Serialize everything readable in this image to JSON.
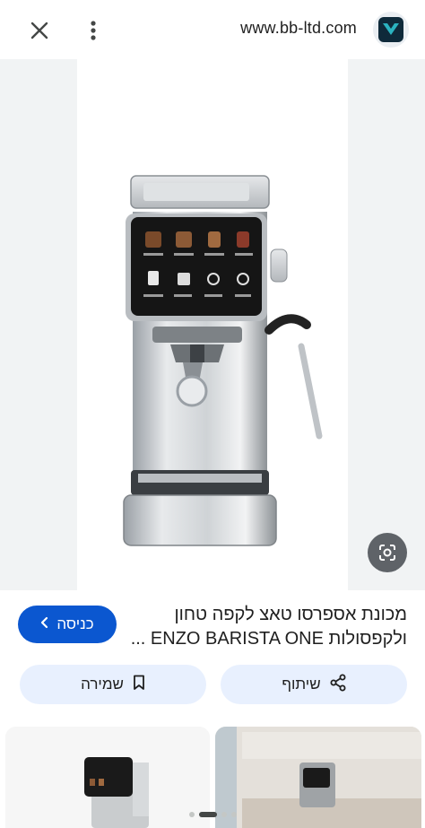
{
  "topbar": {
    "domain": "www.bb-ltd.com",
    "close_icon": "close-icon",
    "more_icon": "more-vert-icon",
    "logo_icon": "site-logo-icon"
  },
  "product": {
    "title": "מכונת אספרסו טאצ לקפה טחון ולקפסולות ENZO BARISTA ONE ..."
  },
  "actions": {
    "visit_label": "כניסה",
    "save_label": "שמירה",
    "share_label": "שיתוף"
  },
  "colors": {
    "accent": "#0b57d0",
    "chip_bg": "#e8f0fe",
    "image_bg": "#f1f3f4"
  }
}
